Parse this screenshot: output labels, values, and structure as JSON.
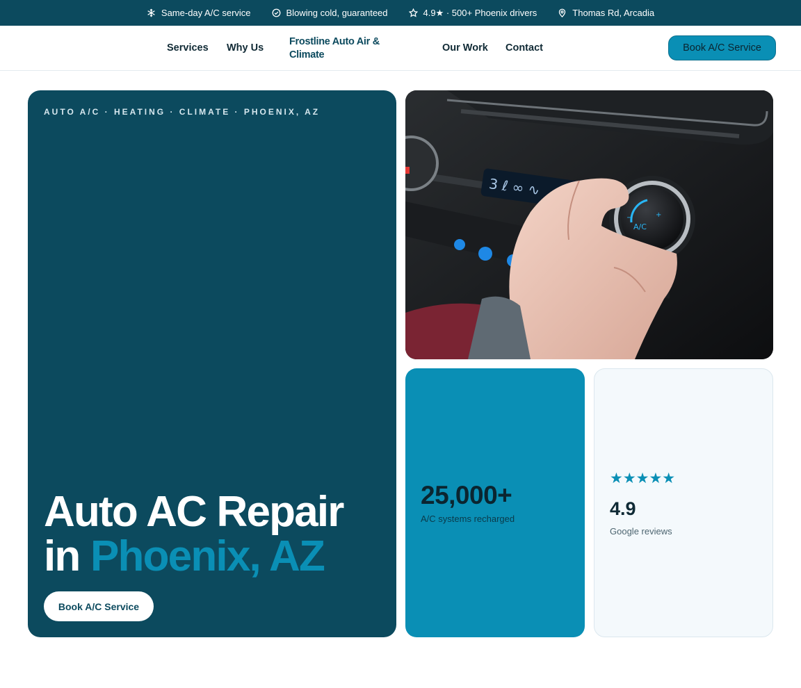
{
  "topbar": {
    "items": [
      {
        "icon": "snowflake-icon",
        "text": "Same-day A/C service"
      },
      {
        "icon": "check-circle-icon",
        "text": "Blowing cold, guaranteed"
      },
      {
        "icon": "star-icon",
        "text": "4.9★ · 500+ Phoenix drivers"
      },
      {
        "icon": "map-pin-icon",
        "text": "Thomas Rd, Arcadia"
      }
    ]
  },
  "nav": {
    "links": [
      "Services",
      "Why Us",
      "Our Work",
      "Contact"
    ],
    "brand": "Frostline Auto Air & Climate",
    "cta": "Book A/C Service"
  },
  "hero": {
    "eyebrow": "AUTO A/C · HEATING · CLIMATE · PHOENIX, AZ",
    "title_line1": "Auto AC Repair",
    "title_line2_plain": "in ",
    "title_line2_accent": "Phoenix, AZ",
    "button": "Book A/C Service"
  },
  "photo": {
    "description_icon": "car-ac-control-photo"
  },
  "stat": {
    "value": "25,000+",
    "label": "A/C systems recharged"
  },
  "review": {
    "stars": "★★★★★",
    "rating": "4.9",
    "label": "Google reviews"
  },
  "colors": {
    "primary_dark": "#0c4a5e",
    "accent": "#0a8fb5",
    "card_light": "#f4f9fc"
  }
}
